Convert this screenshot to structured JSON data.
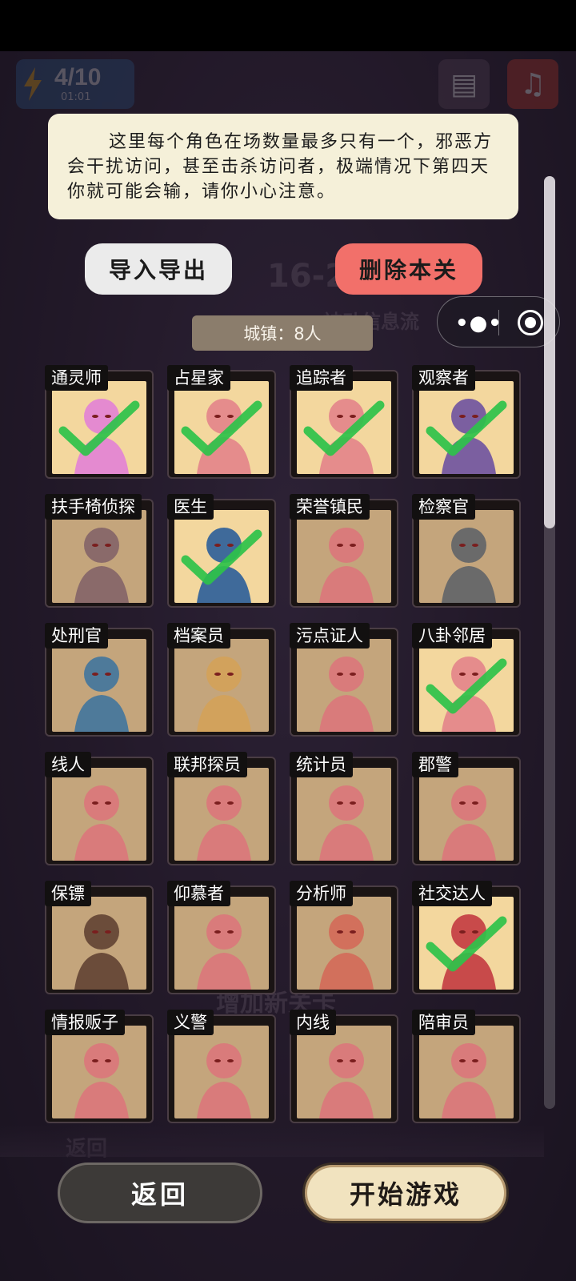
{
  "hud": {
    "energy": "4/10",
    "timer": "01:01"
  },
  "background": {
    "level_hint": "16-2",
    "passive_label": "被动信息流",
    "add_label": "增加新关卡",
    "back_label": "返回"
  },
  "info": {
    "text": "这里每个角色在场数量最多只有一个，邪恶方会干扰访问，甚至击杀访问者，极端情况下第四天你就可能会输，请你小心注意。"
  },
  "buttons": {
    "import_export": "导入导出",
    "delete_level": "删除本关",
    "back": "返回",
    "start_game": "开始游戏"
  },
  "town": {
    "label": "城镇：8人"
  },
  "characters": [
    {
      "name": "通灵师",
      "selected": true,
      "bg": "#f3d79e",
      "color": "#e48ad0"
    },
    {
      "name": "占星家",
      "selected": true,
      "bg": "#f3d79e",
      "color": "#e58c8c"
    },
    {
      "name": "追踪者",
      "selected": true,
      "bg": "#f3d79e",
      "color": "#e58c8c"
    },
    {
      "name": "观察者",
      "selected": true,
      "bg": "#f3d79e",
      "color": "#7b5fa0"
    },
    {
      "name": "扶手椅侦探",
      "selected": false,
      "bg": "#c4a57c",
      "color": "#8a6a6a"
    },
    {
      "name": "医生",
      "selected": true,
      "bg": "#f3d79e",
      "color": "#3f6a9a"
    },
    {
      "name": "荣誉镇民",
      "selected": false,
      "bg": "#c4a57c",
      "color": "#d97b7b"
    },
    {
      "name": "检察官",
      "selected": false,
      "bg": "#c4a57c",
      "color": "#6a6a6a"
    },
    {
      "name": "处刑官",
      "selected": false,
      "bg": "#c4a57c",
      "color": "#4e7a9a"
    },
    {
      "name": "档案员",
      "selected": false,
      "bg": "#c4a57c",
      "color": "#d2a25c"
    },
    {
      "name": "污点证人",
      "selected": false,
      "bg": "#c4a57c",
      "color": "#d97b7b"
    },
    {
      "name": "八卦邻居",
      "selected": true,
      "bg": "#f3d79e",
      "color": "#e58c8c"
    },
    {
      "name": "线人",
      "selected": false,
      "bg": "#c4a57c",
      "color": "#d97b7b"
    },
    {
      "name": "联邦探员",
      "selected": false,
      "bg": "#c4a57c",
      "color": "#d97b7b"
    },
    {
      "name": "统计员",
      "selected": false,
      "bg": "#c4a57c",
      "color": "#d97b7b"
    },
    {
      "name": "郡警",
      "selected": false,
      "bg": "#c4a57c",
      "color": "#d97b7b"
    },
    {
      "name": "保镖",
      "selected": false,
      "bg": "#c4a57c",
      "color": "#6b4c3a"
    },
    {
      "name": "仰慕者",
      "selected": false,
      "bg": "#c4a57c",
      "color": "#d97b7b"
    },
    {
      "name": "分析师",
      "selected": false,
      "bg": "#c4a57c",
      "color": "#d2705c"
    },
    {
      "name": "社交达人",
      "selected": true,
      "bg": "#f3d79e",
      "color": "#c84a4a"
    },
    {
      "name": "情报贩子",
      "selected": false,
      "bg": "#c4a57c",
      "color": "#d97b7b"
    },
    {
      "name": "义警",
      "selected": false,
      "bg": "#c4a57c",
      "color": "#d97b7b"
    },
    {
      "name": "内线",
      "selected": false,
      "bg": "#c4a57c",
      "color": "#d97b7b"
    },
    {
      "name": "陪审员",
      "selected": false,
      "bg": "#c4a57c",
      "color": "#d97b7b"
    }
  ]
}
